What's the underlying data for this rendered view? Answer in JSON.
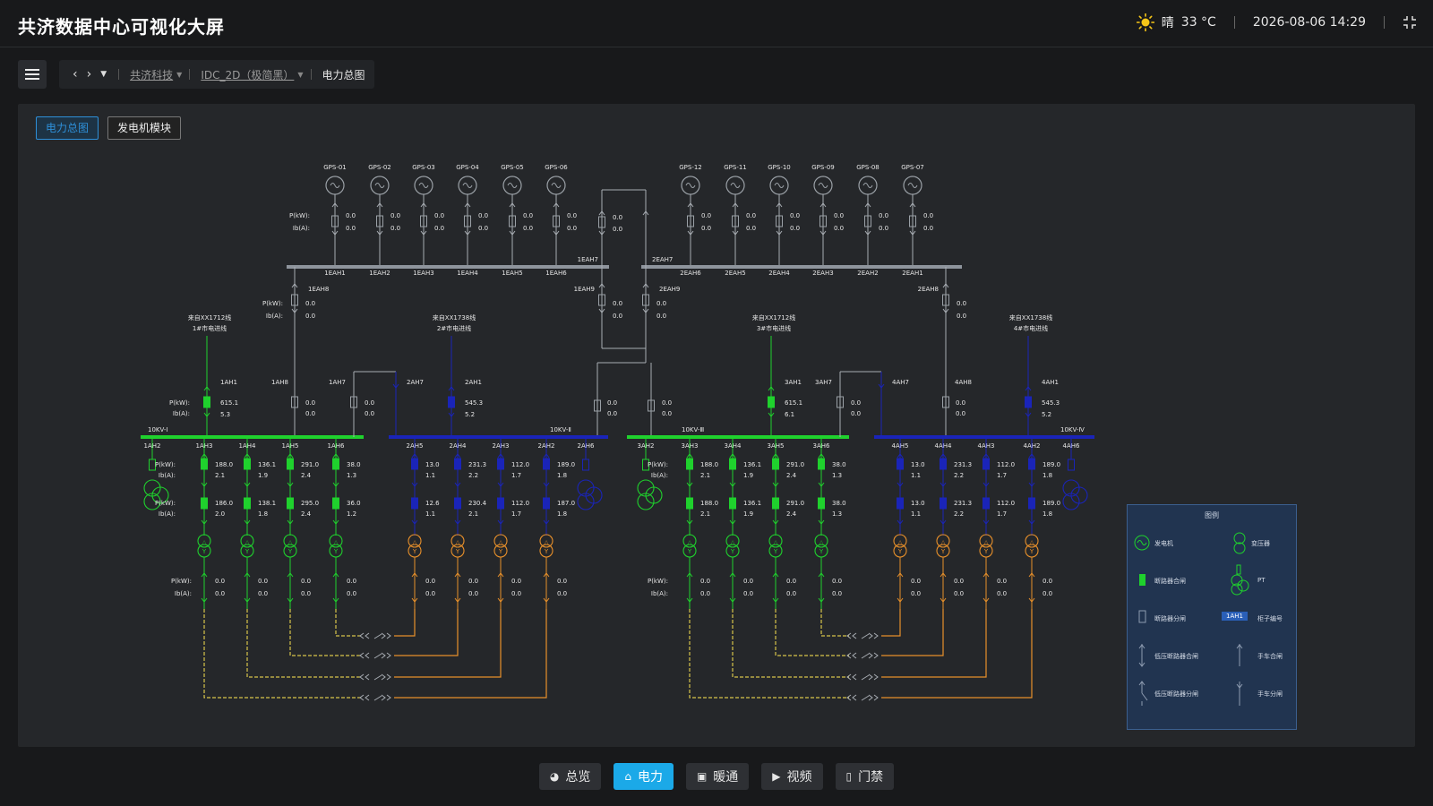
{
  "header": {
    "title": "共济数据中心可视化大屏",
    "weather": "晴",
    "temperature": "33 °C",
    "datetime": "2026-08-06 14:29"
  },
  "nav": {
    "crumb1": "共济科技",
    "crumb2": "IDC_2D（极简黑）",
    "current": "电力总图"
  },
  "tabs": [
    "电力总图",
    "发电机模块"
  ],
  "diagram": {
    "pkw_label": "P(kW):",
    "ib_label": "Ib(A):",
    "gps_left": [
      "GPS-01",
      "GPS-02",
      "GPS-03",
      "GPS-04",
      "GPS-05",
      "GPS-06"
    ],
    "gps_right": [
      "GPS-12",
      "GPS-11",
      "GPS-10",
      "GPS-09",
      "GPS-08",
      "GPS-07"
    ],
    "eah_left": [
      "1EAH1",
      "1EAH2",
      "1EAH3",
      "1EAH4",
      "1EAH5",
      "1EAH6"
    ],
    "eah_right": [
      "2EAH6",
      "2EAH5",
      "2EAH4",
      "2EAH3",
      "2EAH2",
      "2EAH1"
    ],
    "eah_extra": {
      "e1eah7": "1EAH7",
      "e2eah7": "2EAH7",
      "e1eah8": "1EAH8",
      "e1eah9": "1EAH9",
      "e2eah9": "2EAH9",
      "e2eah8": "2EAH8"
    },
    "zero": "0.0",
    "incoming": [
      {
        "line1": "来自XX1712线",
        "line2": "1#市电进线"
      },
      {
        "line1": "来自XX1738线",
        "line2": "2#市电进线"
      },
      {
        "line1": "来自XX1712线",
        "line2": "3#市电进线"
      },
      {
        "line1": "来自XX1738线",
        "line2": "4#市电进线"
      }
    ],
    "buses": [
      "10KV-Ⅰ",
      "10KV-Ⅱ",
      "10KV-Ⅲ",
      "10KV-Ⅳ"
    ],
    "mid_labels": {
      "s1": [
        "1AH1",
        "1AH8",
        "1AH7"
      ],
      "s2": [
        "2AH7",
        "2AH1"
      ],
      "s3": [
        "3AH1",
        "3AH7"
      ],
      "s4": [
        "4AH7",
        "4AH8",
        "4AH1"
      ]
    },
    "mid_values": {
      "i1": [
        "615.1",
        "5.3"
      ],
      "i2": [
        "545.3",
        "5.2"
      ],
      "i3": [
        "615.1",
        "6.1"
      ],
      "i4": [
        "545.3",
        "5.2"
      ]
    },
    "feeders": {
      "f1": [
        "1AH2",
        "1AH3",
        "1AH4",
        "1AH5",
        "1AH6"
      ],
      "f2": [
        "2AH6",
        "2AH5",
        "2AH4",
        "2AH3",
        "2AH2"
      ],
      "f3": [
        "3AH2",
        "3AH3",
        "3AH4",
        "3AH5",
        "3AH6"
      ],
      "f4": [
        "4AH6",
        "4AH5",
        "4AH4",
        "4AH3",
        "4AH2"
      ]
    },
    "v1a": [
      [
        "188.0",
        "2.1"
      ],
      [
        "136.1",
        "1.9"
      ],
      [
        "291.0",
        "2.4"
      ],
      [
        "38.0",
        "1.3"
      ]
    ],
    "v1b": [
      [
        "186.0",
        "2.0"
      ],
      [
        "138.1",
        "1.8"
      ],
      [
        "295.0",
        "2.4"
      ],
      [
        "36.0",
        "1.2"
      ]
    ],
    "v2a": [
      [
        "13.0",
        "1.1"
      ],
      [
        "231.3",
        "2.2"
      ],
      [
        "112.0",
        "1.7"
      ],
      [
        "189.0",
        "1.8"
      ]
    ],
    "v2b": [
      [
        "12.6",
        "1.1"
      ],
      [
        "230.4",
        "2.1"
      ],
      [
        "112.0",
        "1.7"
      ],
      [
        "187.0",
        "1.8"
      ]
    ],
    "v3a": [
      [
        "188.0",
        "2.1"
      ],
      [
        "136.1",
        "1.9"
      ],
      [
        "291.0",
        "2.4"
      ],
      [
        "38.0",
        "1.3"
      ]
    ],
    "v3b": [
      [
        "188.0",
        "2.1"
      ],
      [
        "136.1",
        "1.9"
      ],
      [
        "291.0",
        "2.4"
      ],
      [
        "38.0",
        "1.3"
      ]
    ],
    "v4a": [
      [
        "13.0",
        "1.1"
      ],
      [
        "231.3",
        "2.2"
      ],
      [
        "112.0",
        "1.7"
      ],
      [
        "189.0",
        "1.8"
      ]
    ],
    "v4b": [
      [
        "13.0",
        "1.1"
      ],
      [
        "231.3",
        "2.2"
      ],
      [
        "112.0",
        "1.7"
      ],
      [
        "189.0",
        "1.8"
      ]
    ]
  },
  "legend": {
    "title": "图例",
    "generator": "发电机",
    "transformer": "变压器",
    "breaker_closed": "断路器合闸",
    "pt": "PT",
    "breaker_open": "断路器分闸",
    "cabinet_tag": "1AH1",
    "cabinet_no": "柜子编号",
    "lv_closed": "低压断路器合闸",
    "cart_closed": "手车合闸",
    "lv_open": "低压断路器分闸",
    "cart_open": "手车分闸"
  },
  "bottom_nav": [
    {
      "label": "总览",
      "icon": "pie-icon"
    },
    {
      "label": "电力",
      "icon": "home-icon",
      "active": true
    },
    {
      "label": "暖通",
      "icon": "hvac-icon"
    },
    {
      "label": "视频",
      "icon": "camera-icon"
    },
    {
      "label": "门禁",
      "icon": "door-icon"
    }
  ],
  "colors": {
    "accent": "#1ba9e8",
    "bus_green": "#1fd12d",
    "bus_blue": "#1a24b8",
    "orange": "#e8902a",
    "yellow": "#d8c44a"
  }
}
